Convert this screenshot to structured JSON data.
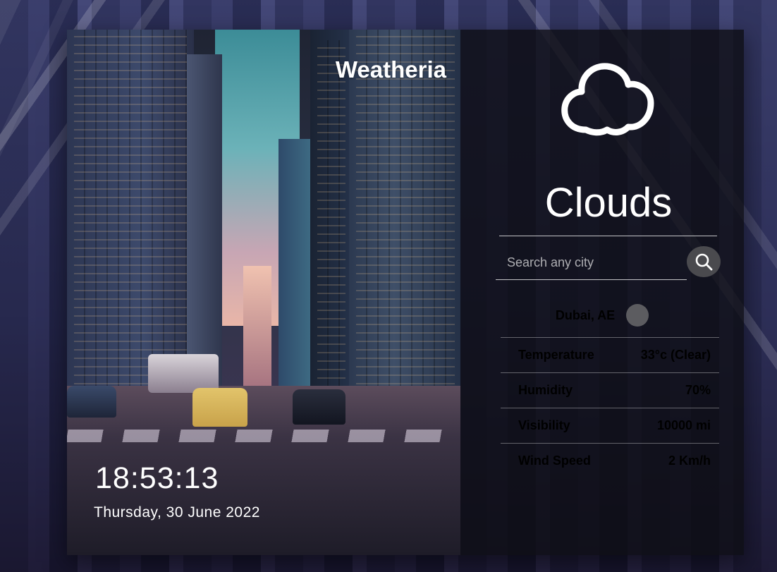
{
  "app": {
    "title": "Weatheria"
  },
  "clock": {
    "time": "18:53:13",
    "date": "Thursday, 30 June 2022"
  },
  "weather": {
    "condition": "Clouds",
    "icon": "cloud-icon",
    "location": "Dubai, AE"
  },
  "search": {
    "placeholder": "Search any city",
    "value": "",
    "button_icon": "search-icon"
  },
  "stats": [
    {
      "label": "Temperature",
      "value": "33°c (Clear)"
    },
    {
      "label": "Humidity",
      "value": "70%"
    },
    {
      "label": "Visibility",
      "value": "10000 mi"
    },
    {
      "label": "Wind Speed",
      "value": "2 Km/h"
    }
  ],
  "colors": {
    "panel_bg": "#0e0e14",
    "search_button": "#4a4a4e",
    "text": "#ffffff"
  }
}
